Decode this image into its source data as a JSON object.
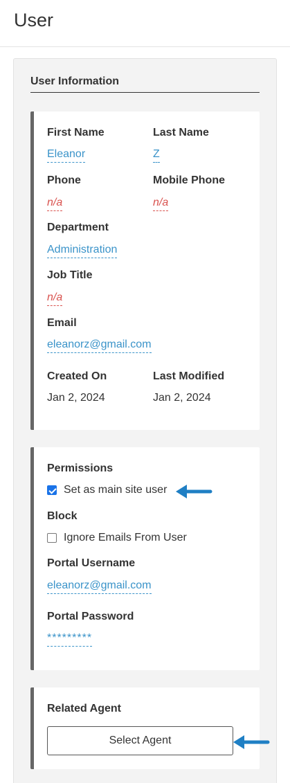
{
  "page": {
    "title": "User"
  },
  "user_info": {
    "heading": "User Information",
    "first_name": {
      "label": "First Name",
      "value": "Eleanor"
    },
    "last_name": {
      "label": "Last Name",
      "value": "Z"
    },
    "phone": {
      "label": "Phone",
      "value": "n/a"
    },
    "mobile_phone": {
      "label": "Mobile Phone",
      "value": "n/a"
    },
    "department": {
      "label": "Department",
      "value": "Administration"
    },
    "job_title": {
      "label": "Job Title",
      "value": "n/a"
    },
    "email": {
      "label": "Email",
      "value": "eleanorz@gmail.com"
    },
    "created_on": {
      "label": "Created On",
      "value": "Jan 2, 2024"
    },
    "last_modified": {
      "label": "Last Modified",
      "value": "Jan 2, 2024"
    }
  },
  "permissions": {
    "label": "Permissions",
    "main_site_user": {
      "label": "Set as main site user",
      "checked": true
    },
    "block_label": "Block",
    "ignore_emails": {
      "label": "Ignore Emails From User",
      "checked": false
    },
    "portal_username": {
      "label": "Portal Username",
      "value": "eleanorz@gmail.com"
    },
    "portal_password": {
      "label": "Portal Password",
      "value": "*********"
    }
  },
  "related_agent": {
    "label": "Related Agent",
    "button_label": "Select Agent"
  },
  "colors": {
    "link": "#3a93c9",
    "empty_value": "#d9534f",
    "checkbox": "#1a73e8",
    "arrow": "#1f7fc4",
    "card_border": "#666666"
  }
}
